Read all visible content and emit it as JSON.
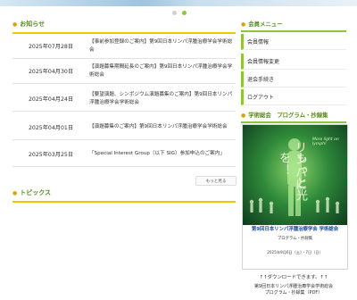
{
  "slider": {
    "dots": 2,
    "active_index": 1
  },
  "news": {
    "heading": "お知らせ",
    "items": [
      {
        "date": "2025年07月28日",
        "title": "【事前参加登録のご案内】第9回日本リンパ浮腫治療学会学術総会"
      },
      {
        "date": "2025年04月30日",
        "title": "【演題募集期間延長のご案内】第9回日本リンパ浮腫治療学会学術総会"
      },
      {
        "date": "2025年04月24日",
        "title": "【要望演題、シンポジウム演題募集のご案内】第9回日本リンパ浮腫治療学会学術総会"
      },
      {
        "date": "2025年04月01日",
        "title": "【演題募集のご案内】第9回日本リンパ浮腫治療学会学術総会"
      },
      {
        "date": "2025年03月25日",
        "title": "「Special Interest Group（以下 SIG）参加申込のご案内」"
      }
    ],
    "more_label": "もっと見る"
  },
  "topics": {
    "heading": "トピックス"
  },
  "sidebar": {
    "member_menu_heading": "会員メニュー",
    "menu_items": [
      "会員情報",
      "会員情報変更",
      "退会手続き",
      "ログアウト"
    ],
    "congress_heading": "学術総会　プログラム・抄録集",
    "poster": {
      "line1": "リンパに",
      "line2": "もっと光を！",
      "tagline": "More light on lymph!",
      "title": "第9回日本リンパ浮腫治療学会 学術総会",
      "subtitle": "プログラム・抄録集",
      "date_line": "2025年9月6日（土）・7日（日）"
    },
    "download_text": "↑↑ダウンロードできます。↑↑",
    "file_name_line1": "第9回日本リンパ浮腫治療学会学術総会",
    "file_name_line2": "プログラム・抄録集（PDF）"
  },
  "colors": {
    "accent_green": "#8cc63f",
    "accent_yellow": "#f3c800"
  }
}
